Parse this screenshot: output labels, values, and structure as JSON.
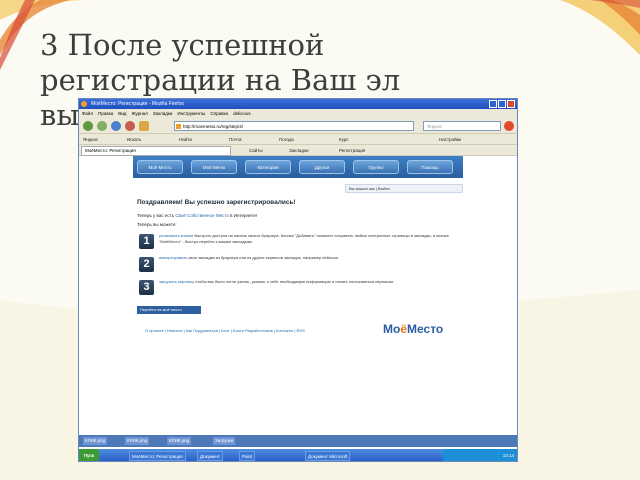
{
  "slide": {
    "title": "3 После успешной регистрации на Ваш эл",
    "title_tail": "вы"
  },
  "browser": {
    "window_title": "МоёМесто: Регистрация - Mozilla Firefox",
    "menu": [
      "Файл",
      "Правка",
      "Вид",
      "Журнал",
      "Закладки",
      "Инструменты",
      "Справка",
      "delicious"
    ],
    "address": "http://moemesto.ru/reg/step/4/",
    "search_placeholder": "Яндекс",
    "toolbar2": [
      "Яндекс",
      "Искать",
      "Найти",
      "Почта",
      "Погода",
      "Курс",
      "Настройки"
    ],
    "toolbar3": [
      "Сайты",
      "Закладки",
      "Регистрация"
    ],
    "tab": "МоёМесто: Регистрация"
  },
  "site": {
    "nav": [
      "Моё Место",
      "Моё Меню",
      "Категории",
      "Друзья",
      "Группы",
      "Помощь"
    ],
    "userbar": "Вы вошли как   |   Выйти",
    "heading": "Поздравляем! Вы успешно зарегистрировались!",
    "intro_prefix": "Теперь у вас есть",
    "intro_link": "Своё Собственное Место",
    "intro_suffix": "в Интернете!",
    "steps_label": "Теперь вы можете:",
    "steps": [
      {
        "num": "1",
        "link": "установить кнопки",
        "text": "быстрого доступа на панель своего браузера. Кнопка \"Добавить\" позволит сохранять любые интересные страницы в закладки, а кнопка \"МоёМесто\" - быстро перейти к вашим закладкам."
      },
      {
        "num": "2",
        "link": "импортировать",
        "text": "свои закладки из браузера или из других сервисов закладок, например delicious."
      },
      {
        "num": "3",
        "link": "загрузить картинку",
        "text": "чтобы вас было легче узнать, указать о себе необходимую информацию и начать пользоваться сервисом."
      }
    ],
    "go_button": "Перейти на моё место",
    "footer": "О проекте  |  Новости  |  Как Подружиться  |  Блог  |  Блоги Разработчиков  |  Контакты  |  RSS",
    "logo_a": "Мо",
    "logo_o": "ё",
    "logo_b": "Место"
  },
  "downloads": [
    "КЛИК.png",
    "КЛИК.png",
    "КЛИК.png",
    "Загрузки"
  ],
  "taskbar": {
    "start": "Пуск",
    "tasks": [
      "МоёМесто: Регистрация",
      "Документ",
      "Paint",
      "Документ Microsoft"
    ],
    "clock": "10:14"
  }
}
